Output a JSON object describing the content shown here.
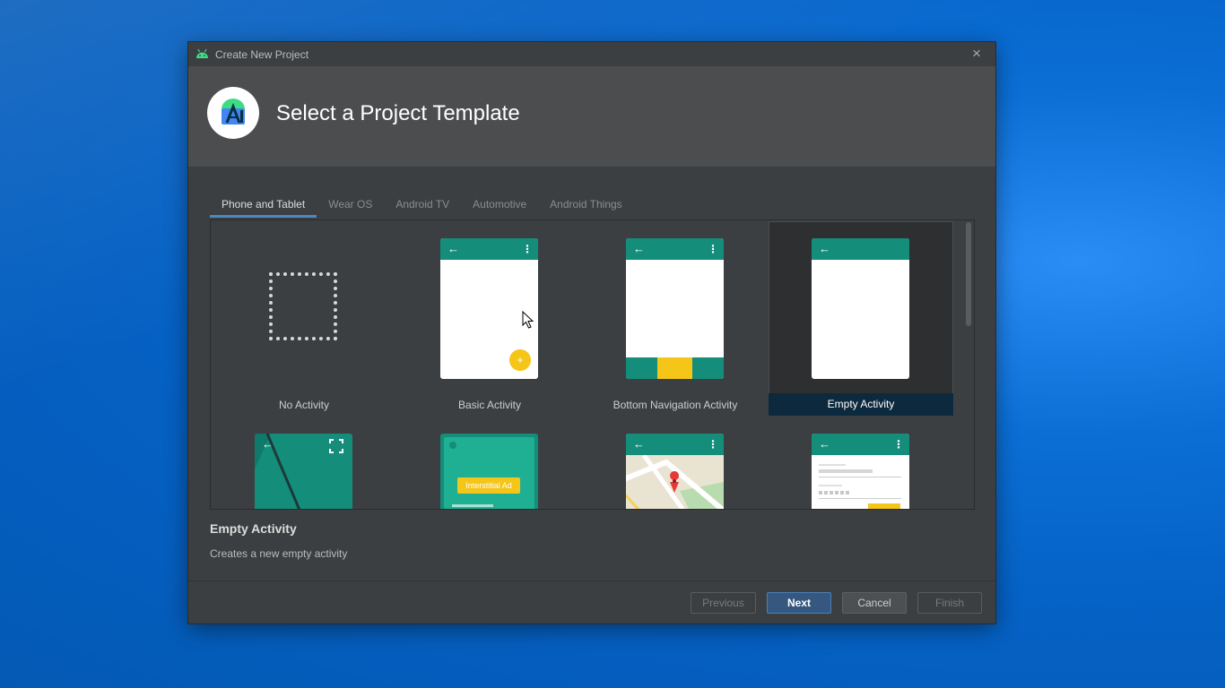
{
  "window": {
    "title": "Create New Project",
    "close_icon": "×"
  },
  "header": {
    "title": "Select a Project Template"
  },
  "tabs": [
    {
      "label": "Phone and Tablet",
      "active": true
    },
    {
      "label": "Wear OS"
    },
    {
      "label": "Android TV"
    },
    {
      "label": "Automotive"
    },
    {
      "label": "Android Things"
    }
  ],
  "templates": [
    {
      "label": "No Activity"
    },
    {
      "label": "Basic Activity"
    },
    {
      "label": "Bottom Navigation Activity"
    },
    {
      "label": "Empty Activity",
      "selected": true
    }
  ],
  "thumb_text": {
    "interstitial": "Interstitial Ad",
    "fab": "+",
    "back": "←",
    "menu": "⋮"
  },
  "description": {
    "title": "Empty Activity",
    "text": "Creates a new empty activity"
  },
  "buttons": {
    "previous": "Previous",
    "next": "Next",
    "cancel": "Cancel",
    "finish": "Finish"
  },
  "colors": {
    "teal": "#148d7a",
    "accent": "#f5c518",
    "selection": "#0d293e",
    "primary_button": "#365880"
  }
}
